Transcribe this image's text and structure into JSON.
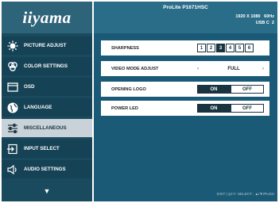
{
  "logo": "iiyama",
  "sidebar": {
    "items": [
      {
        "label": "PICTURE ADJUST",
        "icon": "brightness-sun-icon"
      },
      {
        "label": "COLOR SETTINGS",
        "icon": "color-palette-icon"
      },
      {
        "label": "OSD",
        "icon": "osd-window-icon"
      },
      {
        "label": "LANGUAGE",
        "icon": "globe-icon"
      },
      {
        "label": "MISCELLANEOUS",
        "icon": "sliders-icon",
        "active": true
      },
      {
        "label": "INPUT SELECT",
        "icon": "input-enter-icon"
      },
      {
        "label": "AUDIO SETTINGS",
        "icon": "speaker-icon"
      }
    ],
    "more_arrow": "▼"
  },
  "header": {
    "model": "ProLite P1671HSC",
    "resolution": "1920 X 1080   60Hz",
    "input": "USB C  2"
  },
  "settings": {
    "sharpness": {
      "label": "SHARPNESS",
      "options": [
        "1",
        "2",
        "3",
        "4",
        "5",
        "6"
      ],
      "selected": "3"
    },
    "video_mode": {
      "label": "VIDEO MODE ADJUST",
      "value": "FULL",
      "left_arrow": "‹",
      "right_arrow": "›"
    },
    "opening_logo": {
      "label": "OPENING LOGO",
      "on": "ON",
      "off": "OFF",
      "selected": "ON"
    },
    "power_led": {
      "label": "POWER LED",
      "on": "ON",
      "off": "OFF",
      "selected": "ON"
    }
  },
  "footer": {
    "hint": "EXIT | ◎/+/- SELECT : ▲/▼/PUSH"
  },
  "colors": {
    "sidebar_bg": "#154255",
    "logo_bg": "#2e6479",
    "main_bg": "#1b5a76",
    "header_bg": "#2a6d89",
    "active_item_bg": "#c8d2d8",
    "accent_dark": "#1a3340"
  }
}
